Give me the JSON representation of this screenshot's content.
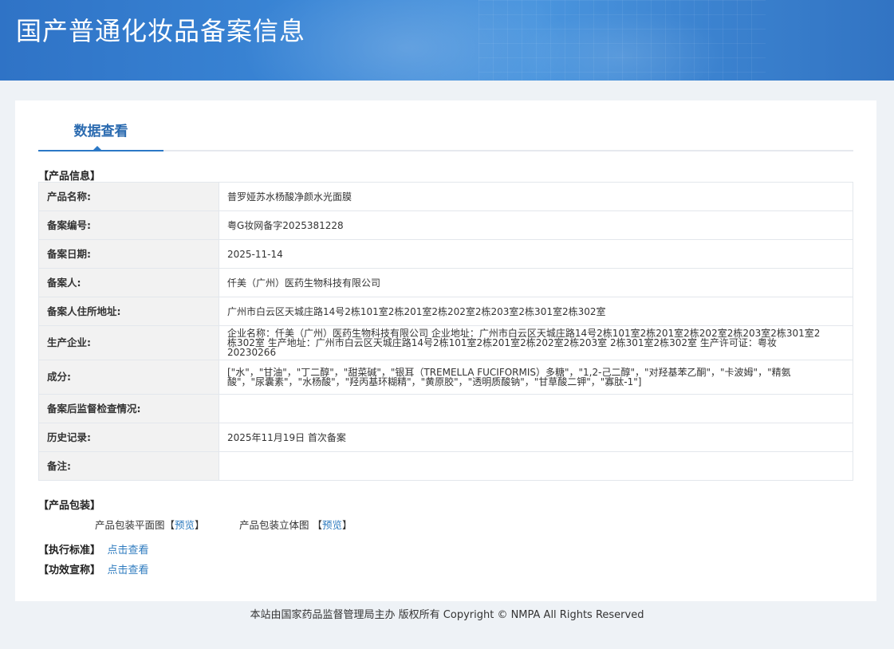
{
  "header": {
    "title": "国产普通化妆品备案信息"
  },
  "tabs": {
    "active": "数据查看"
  },
  "sections": {
    "product_info": "【产品信息】",
    "packaging": "【产品包装】",
    "standard": "【执行标准】",
    "efficacy": "【功效宣称】"
  },
  "rows": [
    {
      "label": "产品名称:",
      "value": "普罗娅苏水杨酸净颜水光面膜"
    },
    {
      "label": "备案编号:",
      "value": "粤G妆网备字2025381228"
    },
    {
      "label": "备案日期:",
      "value": "2025-11-14"
    },
    {
      "label": "备案人:",
      "value": "仟美（广州）医药生物科技有限公司"
    },
    {
      "label": "备案人住所地址:",
      "value": "广州市白云区天城庄路14号2栋101室2栋201室2栋202室2栋203室2栋301室2栋302室"
    },
    {
      "label": "生产企业:",
      "value": "企业名称：仟美（广州）医药生物科技有限公司 企业地址：广州市白云区天城庄路14号2栋101室2栋201室2栋202室2栋203室2栋301室2栋302室 生产地址：广州市白云区天城庄路14号2栋101室2栋201室2栋202室2栋203室 2栋301室2栋302室 生产许可证：粤妆20230266"
    },
    {
      "label": "成分:",
      "value": "[\"水\"，\"甘油\"，\"丁二醇\"，\"甜菜碱\"，\"银耳（TREMELLA FUCIFORMIS）多糖\"，\"1,2-己二醇\"，\"对羟基苯乙酮\"，\"卡波姆\"，\"精氨酸\"，\"尿囊素\"，\"水杨酸\"，\"羟丙基环糊精\"，\"黄原胶\"，\"透明质酸钠\"，\"甘草酸二钾\"，\"寡肽-1\"]"
    },
    {
      "label": "备案后监督检查情况:",
      "value": ""
    },
    {
      "label": "历史记录:",
      "value": "2025年11月19日 首次备案"
    },
    {
      "label": "备注:",
      "value": ""
    }
  ],
  "packaging": {
    "flat_label": "产品包装平面图",
    "solid_label": "产品包装立体图",
    "preview": "预览",
    "bracket_open": "【",
    "bracket_close": "】"
  },
  "links": {
    "view": "点击查看"
  },
  "footer": {
    "text": "本站由国家药品监督管理局主办 版权所有 Copyright © NMPA All Rights Reserved"
  }
}
